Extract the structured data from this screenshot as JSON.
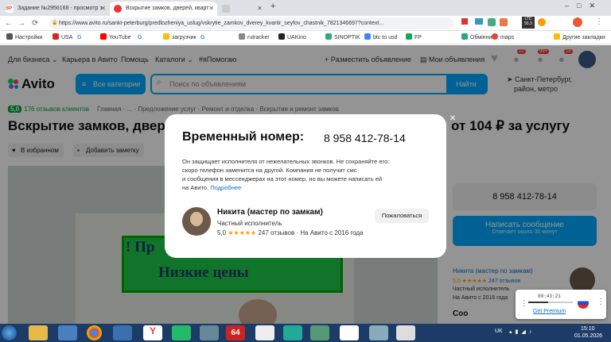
{
  "browser": {
    "tabs": [
      {
        "title": "Задание №2956168 - просмотр з",
        "favicon": "SP",
        "active": false
      },
      {
        "title": "Вскрытие замков, дверей, кварт",
        "active": true
      },
      {
        "title": "",
        "active": false
      }
    ],
    "url": "https://www.avito.ru/sankt-peterburg/predlozheniya_uslug/vskrytie_zamkov_dverey_kvartir_seyfov_chastnik_7821346697?context...",
    "bookmarks": [
      "Настройки",
      "USA",
      "G",
      "YouTube",
      "G",
      "загрузчик",
      "G",
      "rutracker",
      "UAKino",
      "SINOPTIK",
      "btc to usd",
      "FP",
      "Обмінник",
      "maps",
      "Другие закладки"
    ]
  },
  "avito": {
    "nav": {
      "business": "Для бизнеса",
      "career": "Карьера в Авито",
      "help": "Помощь",
      "catalogs": "Каталоги",
      "help_tag": "#яПомогаю",
      "post_ad": "Разместить объявление",
      "my_ads": "Мои объявления",
      "notif_counts": [
        "10",
        "99+",
        "16"
      ]
    },
    "logo": "Avito",
    "categories_btn": "Все категории",
    "search_placeholder": "Поиск по объявлениям",
    "search_btn": "Найти",
    "city": "Санкт-Петербург,",
    "city2": "район, метро",
    "rating": "5,0",
    "reviews_link": "176 отзывов клиентов",
    "breadcrumbs": "Главная · ... · Предложение услуг · Ремонт и отделка · Вскрытие и ремонт замков",
    "title_left": "Вскрытие замков, двер",
    "title_right": "от 104 ₽ за услугу",
    "fav_btn": "В избранном",
    "note_btn": "Добавить заметку",
    "photo_text1": "! Пр",
    "photo_text2": "Низкие цены",
    "phone_btn": "8 958 412-78-14",
    "msg_btn": "Написать сообщение",
    "msg_sub": "Отвечает около 30 минут",
    "seller_name": "Никита (мастер по замкам)",
    "seller_rating": "5,0 ★★★★★",
    "seller_reviews": "247 отзывов",
    "seller_type": "Частный исполнитель",
    "seller_since": "На Авито с 2016 года",
    "cut_text": "Соо"
  },
  "modal": {
    "title": "Временный номер:",
    "phone": "8 958 412-78-14",
    "desc_lines": [
      "Он защищает исполнителя от нежелательных звонков. Не сохраняйте его:",
      "скоро телефон заменится на другой. Компания не получит смс",
      "и сообщения в мессенджерах на этот номер, но вы можете написать ей",
      "на Авито."
    ],
    "more_link": "Подробнее",
    "seller_name": "Никита (мастер по замкам)",
    "seller_type": "Частный исполнитель",
    "rating": "5,0",
    "stars": "★★★★★",
    "reviews": "247 отзывов",
    "since": "· На Авито с 2016 года",
    "report_btn": "Пожаловаться",
    "close": "×"
  },
  "popup": {
    "time": "00:43:21",
    "link": "Get Premium"
  },
  "taskbar": {
    "lang": "UK",
    "time": "15:10",
    "date": "01.05.2026",
    "badge": "64"
  }
}
